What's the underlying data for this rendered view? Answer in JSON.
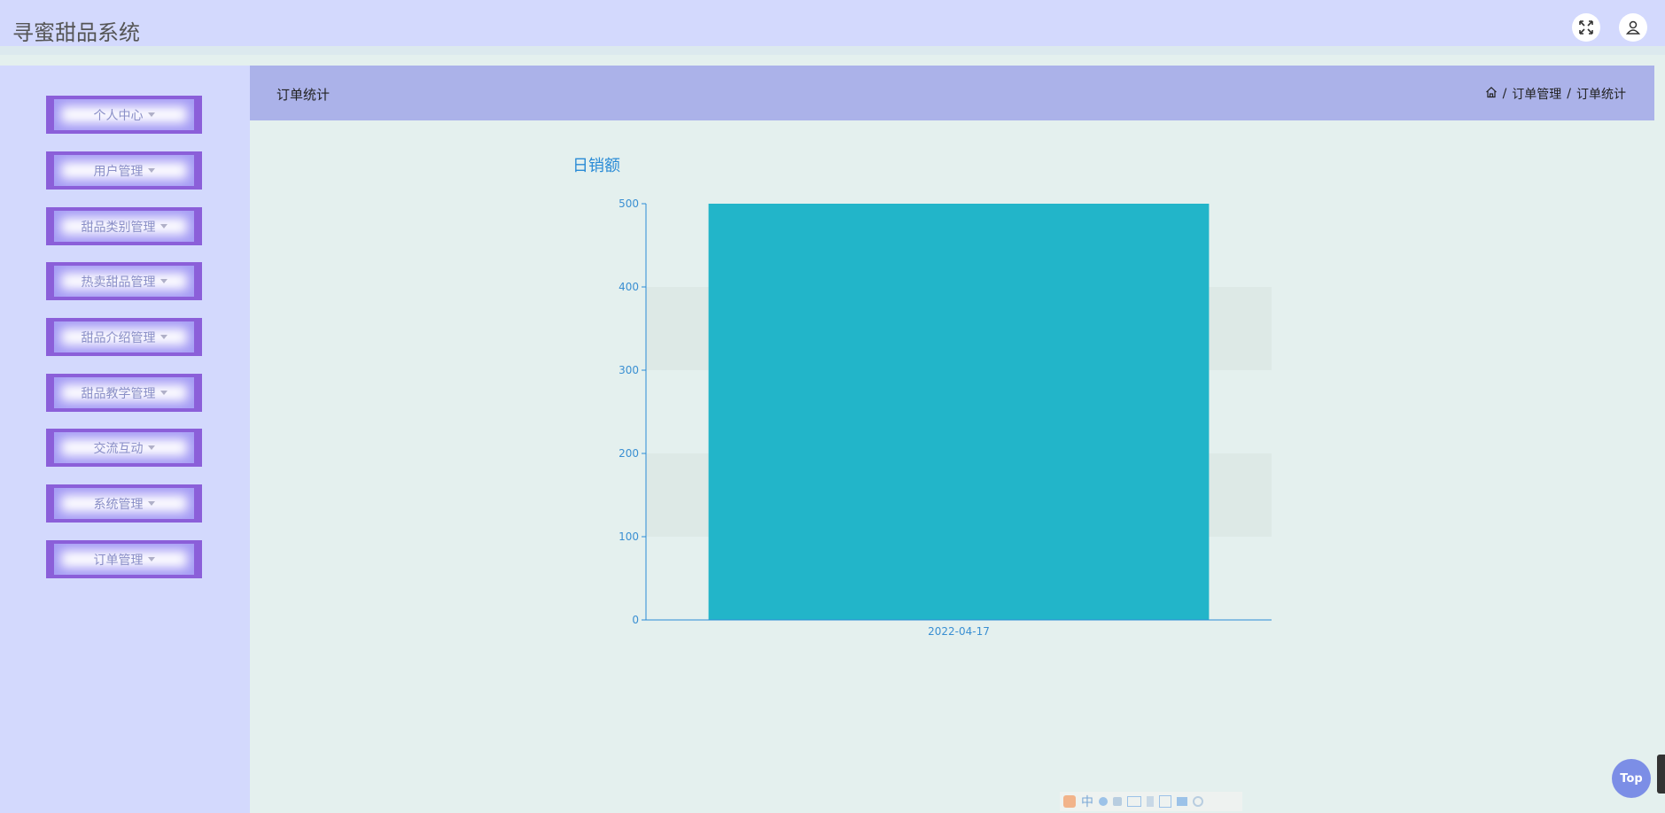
{
  "header": {
    "app_title": "寻蜜甜品系统",
    "icons": [
      "fullscreen-icon",
      "user-icon"
    ]
  },
  "sidebar": {
    "items": [
      {
        "label": "个人中心"
      },
      {
        "label": "用户管理"
      },
      {
        "label": "甜品类别管理"
      },
      {
        "label": "热卖甜品管理"
      },
      {
        "label": "甜品介绍管理"
      },
      {
        "label": "甜品教学管理"
      },
      {
        "label": "交流互动"
      },
      {
        "label": "系统管理"
      },
      {
        "label": "订单管理"
      }
    ]
  },
  "content": {
    "title": "订单统计",
    "breadcrumb": [
      "订单管理",
      "订单统计"
    ]
  },
  "colors": {
    "bar": "#22b5c9",
    "axis": "#2a8bd6",
    "sidebar_bg": "#d3d9fd",
    "header_bg": "#abb2e9"
  },
  "chart_data": {
    "type": "bar",
    "title": "日销额",
    "categories": [
      "2022-04-17"
    ],
    "values": [
      500
    ],
    "ylim": [
      0,
      500
    ],
    "yticks": [
      0,
      100,
      200,
      300,
      400,
      500
    ],
    "xlabel": "",
    "ylabel": "",
    "grid": "alternating bands"
  },
  "back_to_top": {
    "label": "Top"
  },
  "ime_toolbar": {
    "label": "中"
  }
}
